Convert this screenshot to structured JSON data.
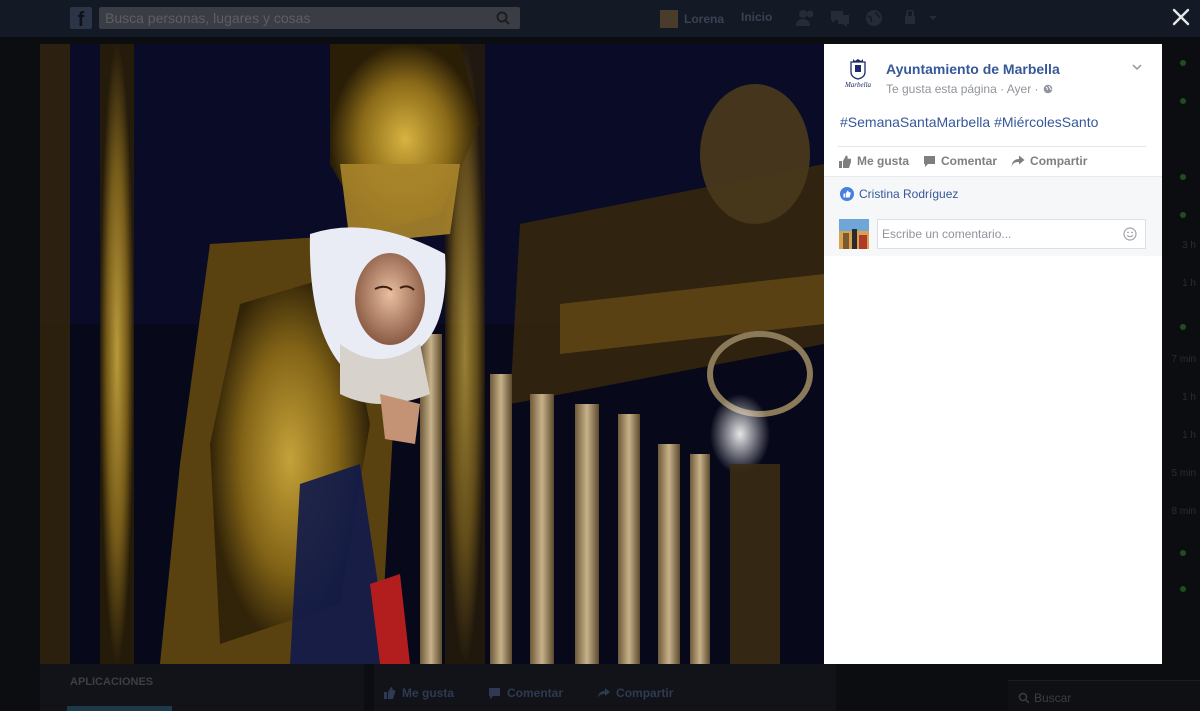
{
  "topbar": {
    "search_placeholder": "Busca personas, lugares y cosas",
    "user_name": "Lorena",
    "home_label": "Inicio"
  },
  "post": {
    "page_name": "Ayuntamiento de Marbella",
    "page_avatar_text": "Marbella",
    "page_meta": "Te gusta esta página · Ayer ·",
    "text": "#SemanaSantaMarbella #MiércolesSanto",
    "actions": {
      "like": "Me gusta",
      "comment": "Comentar",
      "share": "Compartir"
    },
    "liker": "Cristina Rodríguez",
    "comment_placeholder": "Escribe un comentario..."
  },
  "background": {
    "apps_label": "APLICACIONES",
    "actions": {
      "like": "Me gusta",
      "comment": "Comentar",
      "share": "Compartir"
    },
    "chat_search": "Buscar",
    "chat_times": [
      "3 h",
      "1 h",
      "",
      "7 min",
      "1 h",
      "1 h",
      "5 min",
      "8 min"
    ]
  },
  "colors": {
    "link_blue": "#365899",
    "like_blue": "#4a7fe0",
    "online_green": "#42b72a"
  }
}
